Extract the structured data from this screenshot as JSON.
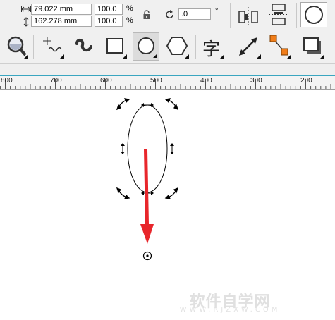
{
  "property_bar": {
    "width_value": "79.022 mm",
    "height_value": "162.278 mm",
    "scale_x": "100.0",
    "scale_y": "100.0",
    "scale_unit_x": "%",
    "scale_unit_y": "%",
    "rotation_value": ".0",
    "degree_symbol": "°"
  },
  "toolbox": {
    "text_tool_glyph": "字",
    "tools": [
      "zoom-tool",
      "freehand-tool",
      "artistic-media-tool",
      "rectangle-tool",
      "ellipse-tool",
      "polygon-tool",
      "text-tool",
      "parallel-dimension-tool",
      "connector-tool",
      "drop-shadow-tool"
    ],
    "active_tool": "ellipse-tool"
  },
  "ruler": {
    "labels": [
      "800",
      "700",
      "600",
      "500",
      "400",
      "300",
      "200"
    ]
  },
  "watermark": {
    "text": "软件自学网",
    "url": "WWW.RJZXW.COM"
  },
  "colors": {
    "arrow_red": "#e8262b",
    "accent_blue": "#3aa6c0",
    "connector_orange": "#f07d1a"
  }
}
